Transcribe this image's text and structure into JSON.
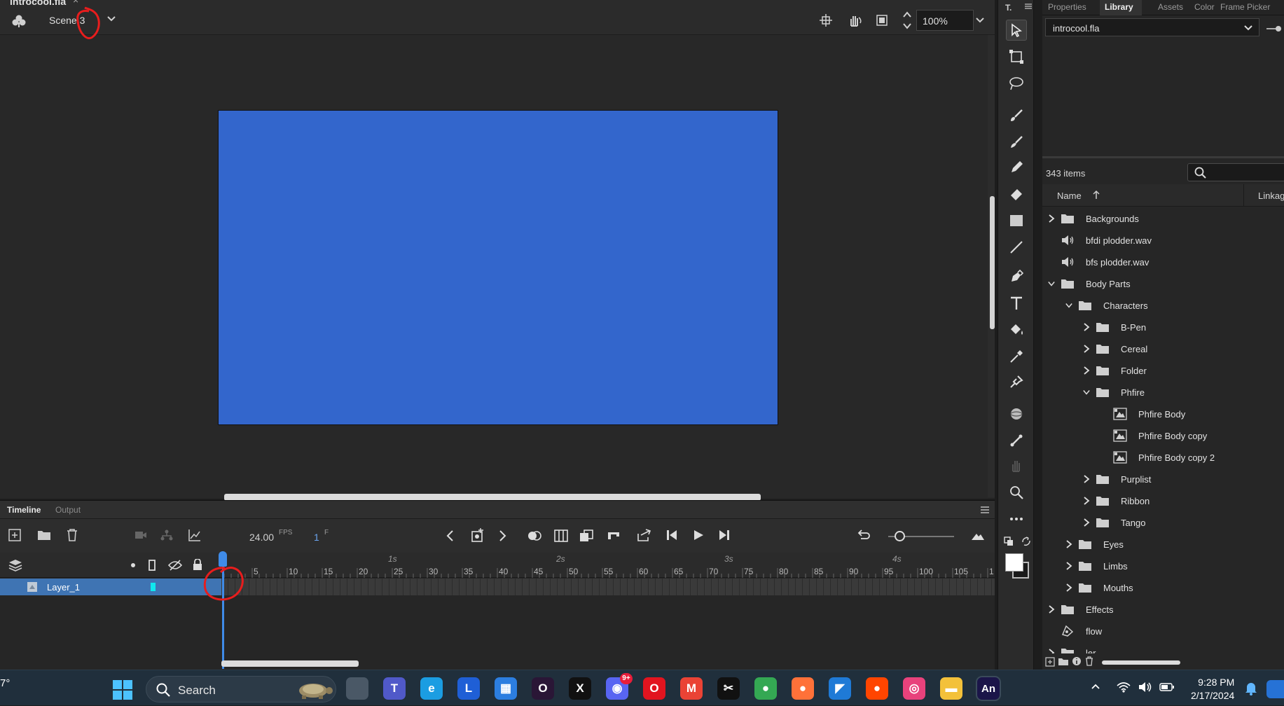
{
  "document": {
    "title": "introcool.fla",
    "close": "×"
  },
  "scene": {
    "name": "Scene 3"
  },
  "zoom": {
    "value": "100%"
  },
  "stage": {
    "color": "#3366cc"
  },
  "timeline": {
    "tabs": [
      "Timeline",
      "Output"
    ],
    "fps_value": "24.00",
    "fps_unit": "FPS",
    "frame_value": "1",
    "frame_unit": "F",
    "layer_name": "Layer_1",
    "layer_color": "#10e7ee",
    "second_marks": [
      "1s",
      "2s",
      "3s",
      "4s"
    ],
    "frame_ticks": [
      "5",
      "10",
      "15",
      "20",
      "25",
      "30",
      "35",
      "40",
      "45",
      "50",
      "55",
      "60",
      "65",
      "70",
      "75",
      "80",
      "85",
      "90",
      "95",
      "100",
      "105",
      "1"
    ]
  },
  "panel": {
    "tabs": [
      "Properties",
      "Library",
      "Assets",
      "Color",
      "Frame Picker"
    ],
    "active_tab": "Library",
    "file": "introcool.fla",
    "items_count": "343 items",
    "columns": {
      "name": "Name",
      "linkage": "Linkag"
    },
    "items": [
      {
        "label": "Backgrounds",
        "type": "folder",
        "depth": 0,
        "expanded": false
      },
      {
        "label": "bfdi plodder.wav",
        "type": "sound",
        "depth": 0
      },
      {
        "label": "bfs plodder.wav",
        "type": "sound",
        "depth": 0
      },
      {
        "label": "Body Parts",
        "type": "folder",
        "depth": 0,
        "expanded": true
      },
      {
        "label": "Characters",
        "type": "folder",
        "depth": 1,
        "expanded": true
      },
      {
        "label": "B-Pen",
        "type": "folder",
        "depth": 2,
        "expanded": false
      },
      {
        "label": "Cereal",
        "type": "folder",
        "depth": 2,
        "expanded": false
      },
      {
        "label": "Folder",
        "type": "folder",
        "depth": 2,
        "expanded": false
      },
      {
        "label": "Phfire",
        "type": "folder",
        "depth": 2,
        "expanded": true
      },
      {
        "label": "Phfire Body",
        "type": "symbol",
        "depth": 3
      },
      {
        "label": "Phfire Body copy",
        "type": "symbol",
        "depth": 3
      },
      {
        "label": "Phfire Body copy 2",
        "type": "symbol",
        "depth": 3
      },
      {
        "label": "Purplist",
        "type": "folder",
        "depth": 2,
        "expanded": false
      },
      {
        "label": "Ribbon",
        "type": "folder",
        "depth": 2,
        "expanded": false
      },
      {
        "label": "Tango",
        "type": "folder",
        "depth": 2,
        "expanded": false
      },
      {
        "label": "Eyes",
        "type": "folder",
        "depth": 1,
        "expanded": false
      },
      {
        "label": "Limbs",
        "type": "folder",
        "depth": 1,
        "expanded": false
      },
      {
        "label": "Mouths",
        "type": "folder",
        "depth": 1,
        "expanded": false
      },
      {
        "label": "Effects",
        "type": "folder",
        "depth": 0,
        "expanded": false
      },
      {
        "label": "flow",
        "type": "graphic",
        "depth": 0
      },
      {
        "label": "ler",
        "type": "folder",
        "depth": 0
      }
    ]
  },
  "taskbar": {
    "search_label": "Search",
    "discord_badge": "9+",
    "time": "9:28 PM",
    "date": "2/17/2024",
    "weather": "7°",
    "apps": [
      {
        "name": "task-view",
        "glyph": "",
        "color": "#4a5866"
      },
      {
        "name": "teams",
        "glyph": "T",
        "color": "#5059c9"
      },
      {
        "name": "edge",
        "glyph": "e",
        "color": "#1b9de2"
      },
      {
        "name": "l-app",
        "glyph": "L",
        "color": "#1f5fd6"
      },
      {
        "name": "store",
        "glyph": "▦",
        "color": "#2c7ee0"
      },
      {
        "name": "opera-gx",
        "glyph": "O",
        "color": "#2a1636"
      },
      {
        "name": "x",
        "glyph": "X",
        "color": "#111111"
      },
      {
        "name": "discord",
        "glyph": "◉",
        "color": "#5865f2"
      },
      {
        "name": "opera",
        "glyph": "O",
        "color": "#e2141f"
      },
      {
        "name": "gmail",
        "glyph": "M",
        "color": "#ea4335"
      },
      {
        "name": "capcut",
        "glyph": "✂",
        "color": "#111111"
      },
      {
        "name": "chrome",
        "glyph": "●",
        "color": "#34a853"
      },
      {
        "name": "firefox",
        "glyph": "●",
        "color": "#ff7139"
      },
      {
        "name": "vscode",
        "glyph": "◤",
        "color": "#1f7ad6"
      },
      {
        "name": "reddit",
        "glyph": "●",
        "color": "#ff4500"
      },
      {
        "name": "creative-cloud",
        "glyph": "◎",
        "color": "#e8427c"
      },
      {
        "name": "file-explorer",
        "glyph": "▬",
        "color": "#f3c13a"
      },
      {
        "name": "animate",
        "glyph": "An",
        "color": "#1b1549"
      }
    ]
  }
}
